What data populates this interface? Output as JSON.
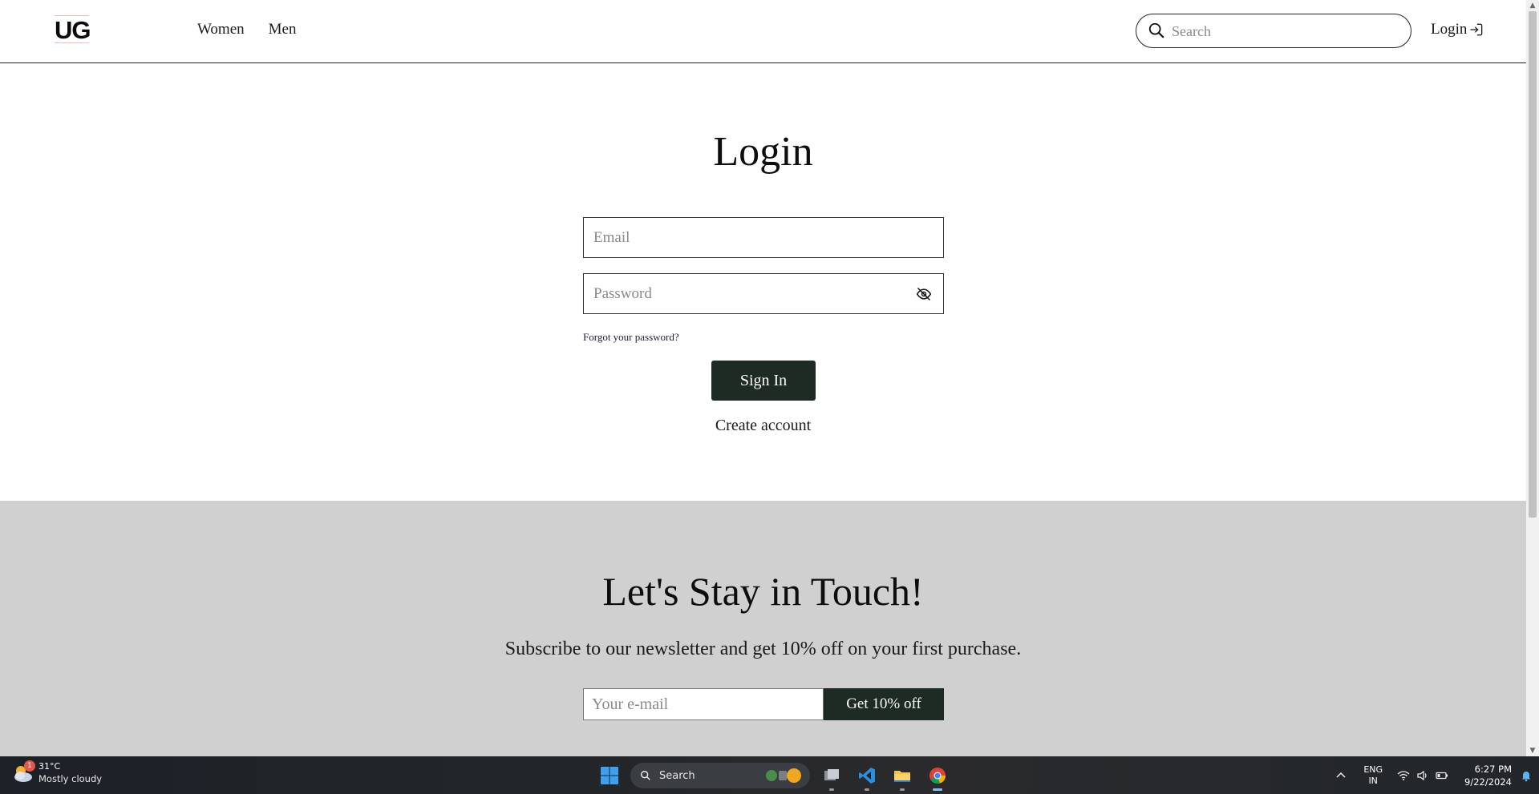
{
  "header": {
    "logo": "UG",
    "nav": [
      "Women",
      "Men"
    ],
    "search_placeholder": "Search",
    "login_label": "Login"
  },
  "login_form": {
    "title": "Login",
    "email_placeholder": "Email",
    "password_placeholder": "Password",
    "forgot_label": "Forgot your password?",
    "sign_in_label": "Sign In",
    "create_account_label": "Create account"
  },
  "newsletter": {
    "title": "Let's Stay in Touch!",
    "subtitle": "Subscribe to our newsletter and get 10% off on your first purchase.",
    "email_placeholder": "Your e-mail",
    "button_label": "Get 10% off"
  },
  "taskbar": {
    "weather_temp": "31°C",
    "weather_condition": "Mostly cloudy",
    "weather_badge": "1",
    "search_label": "Search",
    "language_line1": "ENG",
    "language_line2": "IN",
    "time": "6:27 PM",
    "date": "9/22/2024",
    "apps": [
      "file-manager-icon",
      "vscode-icon",
      "file-explorer-icon",
      "chrome-icon"
    ]
  },
  "colors": {
    "button_bg": "#1e2b24",
    "newsletter_bg": "#d0d0d0",
    "taskbar_bg": "#202327"
  }
}
